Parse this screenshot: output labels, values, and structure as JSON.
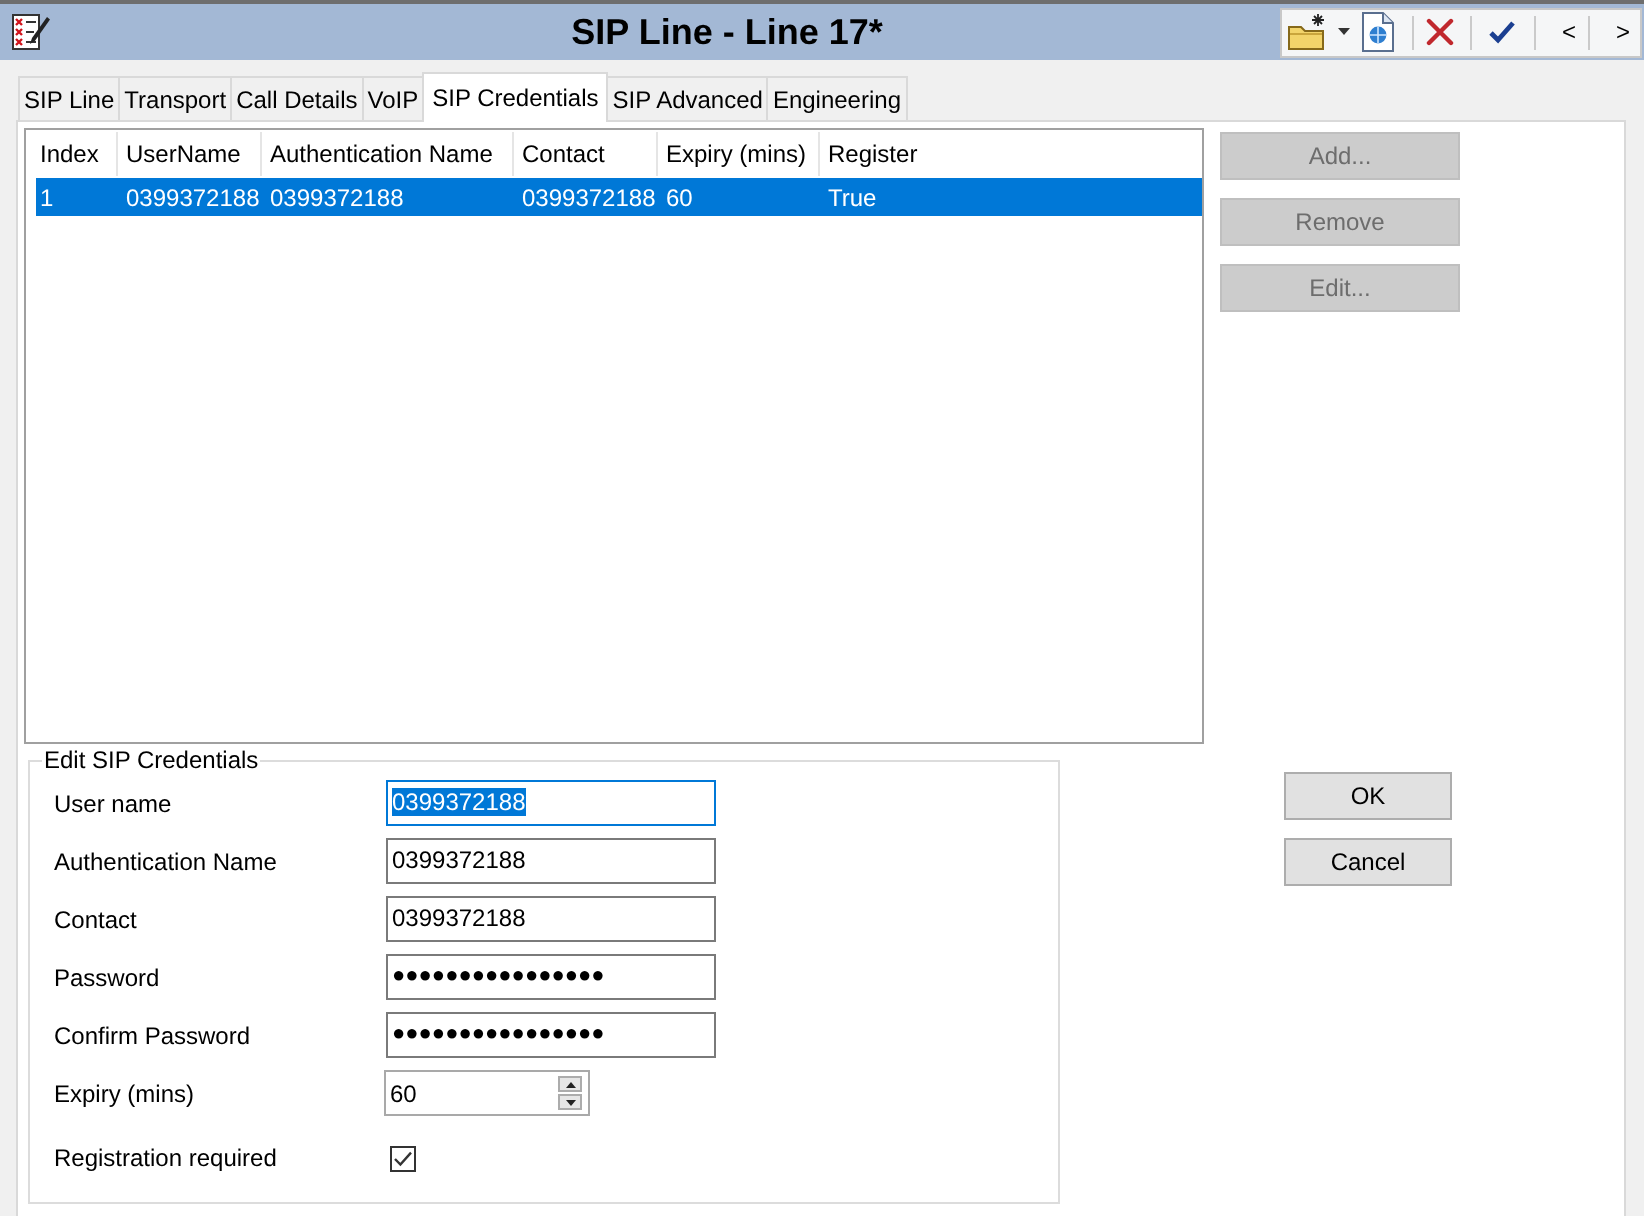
{
  "window": {
    "title": "SIP Line - Line 17*"
  },
  "toolbar": {
    "nav_buttons": [
      "<",
      ">"
    ]
  },
  "tabs": [
    {
      "label": "SIP Line",
      "selected": false
    },
    {
      "label": "Transport",
      "selected": false
    },
    {
      "label": "Call Details",
      "selected": false
    },
    {
      "label": "VoIP",
      "selected": false
    },
    {
      "label": "SIP Credentials",
      "selected": true
    },
    {
      "label": "SIP Advanced",
      "selected": false
    },
    {
      "label": "Engineering",
      "selected": false
    }
  ],
  "credentials_list": {
    "columns": [
      "Index",
      "UserName",
      "Authentication Name",
      "Contact",
      "Expiry (mins)",
      "Register"
    ],
    "rows": [
      {
        "cells": [
          "1",
          "0399372188",
          "0399372188",
          "0399372188",
          "60",
          "True"
        ],
        "selected": true
      }
    ]
  },
  "list_buttons": [
    {
      "label": "Add...",
      "disabled": true
    },
    {
      "label": "Remove",
      "disabled": true
    },
    {
      "label": "Edit...",
      "disabled": true
    }
  ],
  "edit_credentials": {
    "title": "Edit SIP Credentials",
    "fields": [
      {
        "kind": "text",
        "label": "User name",
        "value": "0399372188",
        "focused": true
      },
      {
        "kind": "text",
        "label": "Authentication Name",
        "value": "0399372188",
        "focused": false
      },
      {
        "kind": "text",
        "label": "Contact",
        "value": "0399372188",
        "focused": false
      },
      {
        "kind": "password",
        "label": "Password",
        "value": "●●●●●●●●●●●●●●●●",
        "focused": false
      },
      {
        "kind": "password",
        "label": "Confirm Password",
        "value": "●●●●●●●●●●●●●●●●",
        "focused": false
      },
      {
        "kind": "spin",
        "label": "Expiry (mins)",
        "value": "60",
        "focused": false
      },
      {
        "kind": "checkbox",
        "label": "Registration required",
        "checked": true
      }
    ]
  },
  "dialog_buttons": [
    {
      "label": "OK"
    },
    {
      "label": "Cancel"
    }
  ]
}
